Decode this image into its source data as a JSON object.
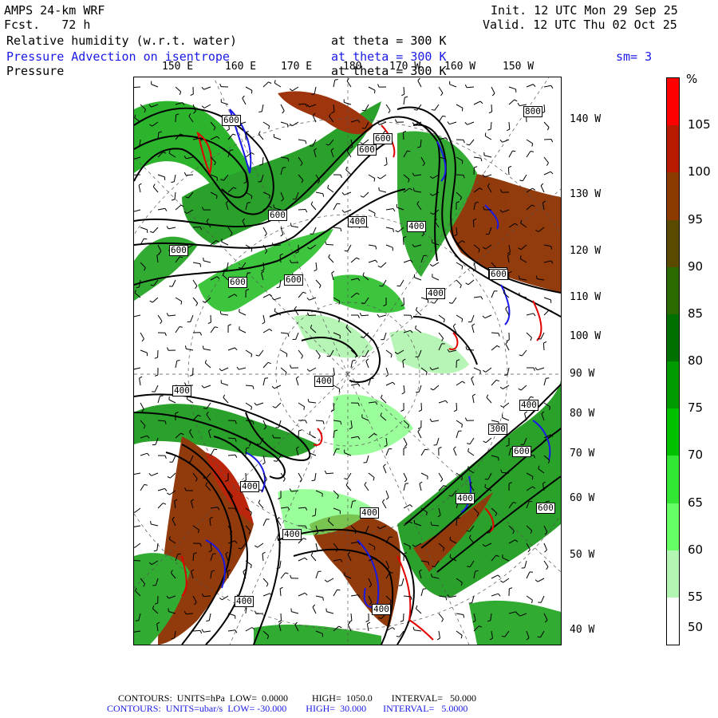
{
  "header": {
    "model": "AMPS 24-km WRF",
    "fcst": "Fcst.   72 h",
    "init": "Init. 12 UTC Mon 29 Sep 25",
    "valid": "Valid. 12 UTC Thu 02 Oct 25",
    "field1": "Relative humidity (w.r.t. water)",
    "field1_level": "at theta = 300 K",
    "field2": "Pressure Advection on isentrope",
    "field2_level": "at theta = 300 K",
    "smoothing": "sm= 3",
    "field3": "Pressure",
    "field3_level": "at theta = 300 K"
  },
  "map": {
    "lon_labels": [
      "150 E",
      "160 E",
      "170 E",
      "180",
      "170 W",
      "160 W",
      "150 W"
    ],
    "lat_labels": [
      "140 W",
      "130 W",
      "120 W",
      "110 W",
      "100 W",
      "90 W",
      "80 W",
      "70 W",
      "60 W",
      "50 W",
      "40 W"
    ],
    "contour_labels": [
      "600",
      "600",
      "600",
      "600",
      "400",
      "400",
      "600",
      "400",
      "600",
      "400",
      "800",
      "400",
      "400",
      "400",
      "300",
      "400",
      "600",
      "600",
      "400",
      "400",
      "400",
      "600",
      "600",
      "400",
      "600"
    ]
  },
  "colorbar": {
    "unit": "%",
    "ticks": [
      "105",
      "100",
      "95",
      "90",
      "85",
      "80",
      "75",
      "70",
      "65",
      "60",
      "55",
      "50"
    ],
    "colors": [
      "#ff0000",
      "#b81a00",
      "#8c3a00",
      "#5a4a00",
      "#2a6a00",
      "#007000",
      "#009a00",
      "#00c000",
      "#33e633",
      "#66ff66",
      "#b3f5b3",
      "#ffffff"
    ]
  },
  "footer": {
    "line1": "CONTOURS:  UNITS=hPa  LOW=  0.0000          HIGH=  1050.0        INTERVAL=   50.000",
    "line2": "CONTOURS:  UNITS=ubar/s  LOW= -30.000        HIGH=  30.000       INTERVAL=   5.0000"
  }
}
